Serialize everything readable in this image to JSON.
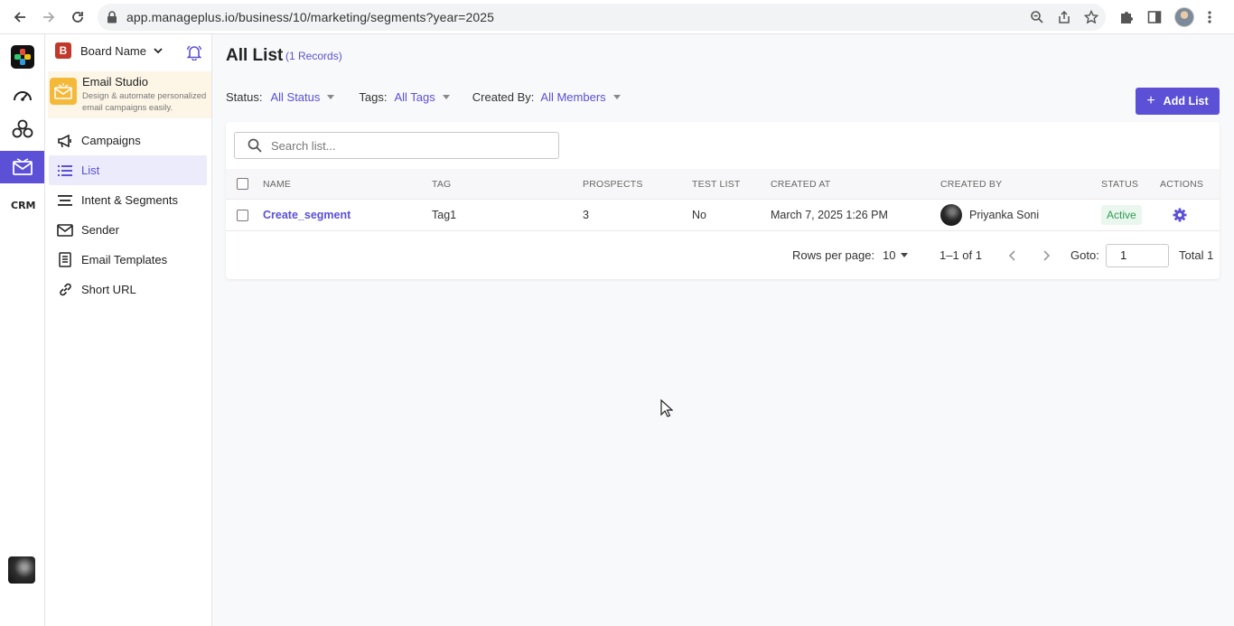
{
  "browser": {
    "url": "app.manageplus.io/business/10/marketing/segments?year=2025"
  },
  "rail": {
    "icons": [
      "app-logo-icon",
      "dashboard-icon",
      "segments-icon",
      "email-marketing-icon",
      "crm-icon"
    ]
  },
  "sidebar": {
    "board_badge": "B",
    "board_name": "Board Name",
    "studio_title": "Email Studio",
    "studio_subtitle": "Design & automate personalized email campaigns easily.",
    "items": [
      {
        "label": "Campaigns",
        "icon": "megaphone-icon",
        "active": false
      },
      {
        "label": "List",
        "icon": "list-icon",
        "active": true
      },
      {
        "label": "Intent & Segments",
        "icon": "segments-lines-icon",
        "active": false
      },
      {
        "label": "Sender",
        "icon": "sender-mail-icon",
        "active": false
      },
      {
        "label": "Email Templates",
        "icon": "template-icon",
        "active": false
      },
      {
        "label": "Short URL",
        "icon": "link-icon",
        "active": false
      }
    ]
  },
  "main": {
    "title": "All List",
    "records": "(1 Records)",
    "filters": [
      {
        "label": "Status:",
        "value": "All Status"
      },
      {
        "label": "Tags:",
        "value": "All Tags"
      },
      {
        "label": "Created By:",
        "value": "All Members"
      }
    ],
    "add_button": "Add List",
    "search_placeholder": "Search list...",
    "columns": [
      "NAME",
      "TAG",
      "PROSPECTS",
      "TEST LIST",
      "CREATED AT",
      "CREATED BY",
      "STATUS",
      "ACTIONS"
    ],
    "rows": [
      {
        "name": "Create_segment",
        "tag": "Tag1",
        "prospects": "3",
        "test_list": "No",
        "created_at": "March 7, 2025 1:26 PM",
        "created_by": "Priyanka Soni",
        "status": "Active"
      }
    ],
    "pager": {
      "rows_label": "Rows per page:",
      "rows_value": "10",
      "range": "1–1 of 1",
      "goto_label": "Goto:",
      "goto_value": "1",
      "total": "Total 1"
    }
  },
  "colors": {
    "accent": "#5b50d6",
    "status_active_text": "#2e9b50",
    "studio_bg": "#fdf6e7",
    "board_badge": "#c0392b"
  }
}
